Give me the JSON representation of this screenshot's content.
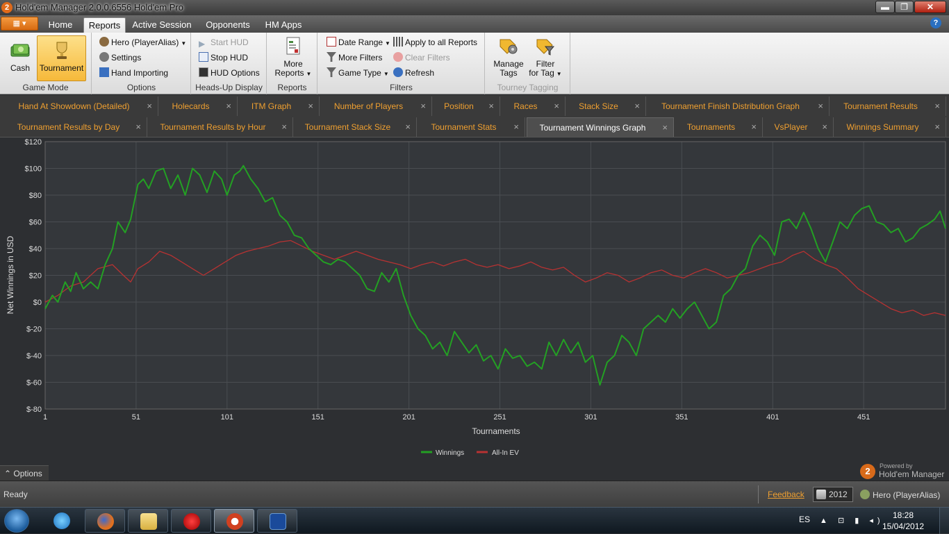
{
  "window": {
    "title": "Hold'em Manager 2.0.0.6556 Hold'em Pro",
    "logo_text": "2",
    "minimize": "▬",
    "maximize": "❐",
    "close": "✕"
  },
  "ribbon_tabs": [
    "Home",
    "Reports",
    "Active Session",
    "Opponents",
    "HM Apps"
  ],
  "active_ribbon_tab": "Reports",
  "help": "?",
  "ribbon": {
    "game_mode": {
      "label": "Game Mode",
      "cash": "Cash",
      "tournament": "Tournament"
    },
    "options": {
      "label": "Options",
      "hero": "Hero (PlayerAlias)",
      "settings": "Settings",
      "hand_importing": "Hand Importing"
    },
    "heads_up": {
      "label": "Heads-Up Display",
      "start_hud": "Start HUD",
      "stop_hud": "Stop HUD",
      "hud_options": "HUD Options"
    },
    "reports": {
      "label": "Reports",
      "more_reports_1": "More",
      "more_reports_2": "Reports"
    },
    "filters": {
      "label": "Filters",
      "date_range": "Date Range",
      "more_filters": "More Filters",
      "game_type": "Game Type",
      "apply_all": "Apply to all Reports",
      "clear_filters": "Clear Filters",
      "refresh": "Refresh"
    },
    "tourney_tagging": {
      "label": "Tourney Tagging",
      "manage_1": "Manage",
      "manage_2": "Tags",
      "filter_1": "Filter",
      "filter_2": "for Tag"
    }
  },
  "report_tabs_row1": [
    "Hand At Showdown (Detailed)",
    "Holecards",
    "ITM Graph",
    "Number of Players",
    "Position",
    "Races",
    "Stack Size",
    "Tournament Finish Distribution Graph",
    "Tournament Results"
  ],
  "report_tabs_row2": [
    "Tournament Results by Day",
    "Tournament Results by Hour",
    "Tournament Stack Size",
    "Tournament Stats",
    "Tournament Winnings Graph",
    "Tournaments",
    "VsPlayer",
    "Winnings Summary"
  ],
  "active_report_tab": "Tournament Winnings Graph",
  "tab_close": "×",
  "chart_data": {
    "type": "line",
    "title": "",
    "xlabel": "Tournaments",
    "ylabel": "Net Winnings in USD",
    "xlim": [
      1,
      496
    ],
    "ylim": [
      -80,
      120
    ],
    "x_ticks": [
      1,
      51,
      101,
      151,
      201,
      251,
      301,
      351,
      401,
      451
    ],
    "y_ticks": [
      "$120",
      "$100",
      "$80",
      "$60",
      "$40",
      "$20",
      "$0",
      "$-20",
      "$-40",
      "$-60",
      "$-80"
    ],
    "y_tick_values": [
      120,
      100,
      80,
      60,
      40,
      20,
      0,
      -20,
      -40,
      -60,
      -80
    ],
    "grid": true,
    "legend_position": "bottom-center",
    "series": [
      {
        "name": "Winnings",
        "color": "#23a023",
        "points": [
          [
            1,
            -5
          ],
          [
            5,
            5
          ],
          [
            8,
            0
          ],
          [
            12,
            15
          ],
          [
            15,
            8
          ],
          [
            18,
            22
          ],
          [
            22,
            10
          ],
          [
            26,
            15
          ],
          [
            30,
            10
          ],
          [
            34,
            28
          ],
          [
            38,
            40
          ],
          [
            41,
            60
          ],
          [
            45,
            52
          ],
          [
            48,
            62
          ],
          [
            52,
            88
          ],
          [
            55,
            92
          ],
          [
            58,
            85
          ],
          [
            62,
            98
          ],
          [
            66,
            100
          ],
          [
            70,
            85
          ],
          [
            74,
            95
          ],
          [
            78,
            80
          ],
          [
            82,
            100
          ],
          [
            86,
            95
          ],
          [
            90,
            82
          ],
          [
            94,
            98
          ],
          [
            98,
            92
          ],
          [
            101,
            80
          ],
          [
            105,
            95
          ],
          [
            108,
            98
          ],
          [
            110,
            102
          ],
          [
            114,
            92
          ],
          [
            118,
            85
          ],
          [
            122,
            75
          ],
          [
            126,
            78
          ],
          [
            130,
            65
          ],
          [
            134,
            60
          ],
          [
            138,
            50
          ],
          [
            142,
            48
          ],
          [
            146,
            40
          ],
          [
            150,
            35
          ],
          [
            154,
            30
          ],
          [
            158,
            28
          ],
          [
            162,
            32
          ],
          [
            166,
            30
          ],
          [
            170,
            25
          ],
          [
            174,
            20
          ],
          [
            178,
            10
          ],
          [
            182,
            8
          ],
          [
            186,
            22
          ],
          [
            190,
            15
          ],
          [
            194,
            25
          ],
          [
            198,
            5
          ],
          [
            202,
            -10
          ],
          [
            206,
            -20
          ],
          [
            210,
            -25
          ],
          [
            214,
            -35
          ],
          [
            218,
            -30
          ],
          [
            222,
            -40
          ],
          [
            226,
            -22
          ],
          [
            230,
            -30
          ],
          [
            234,
            -38
          ],
          [
            238,
            -32
          ],
          [
            242,
            -44
          ],
          [
            246,
            -40
          ],
          [
            250,
            -50
          ],
          [
            254,
            -35
          ],
          [
            258,
            -42
          ],
          [
            262,
            -40
          ],
          [
            266,
            -48
          ],
          [
            270,
            -45
          ],
          [
            274,
            -50
          ],
          [
            278,
            -30
          ],
          [
            282,
            -40
          ],
          [
            286,
            -28
          ],
          [
            290,
            -38
          ],
          [
            294,
            -30
          ],
          [
            298,
            -45
          ],
          [
            302,
            -40
          ],
          [
            306,
            -62
          ],
          [
            310,
            -45
          ],
          [
            314,
            -40
          ],
          [
            318,
            -25
          ],
          [
            322,
            -30
          ],
          [
            326,
            -40
          ],
          [
            330,
            -20
          ],
          [
            334,
            -15
          ],
          [
            338,
            -10
          ],
          [
            342,
            -15
          ],
          [
            346,
            -5
          ],
          [
            350,
            -12
          ],
          [
            354,
            -5
          ],
          [
            358,
            0
          ],
          [
            362,
            -10
          ],
          [
            366,
            -20
          ],
          [
            370,
            -15
          ],
          [
            374,
            5
          ],
          [
            378,
            10
          ],
          [
            382,
            20
          ],
          [
            386,
            25
          ],
          [
            390,
            42
          ],
          [
            394,
            50
          ],
          [
            398,
            45
          ],
          [
            402,
            35
          ],
          [
            406,
            60
          ],
          [
            410,
            62
          ],
          [
            414,
            55
          ],
          [
            418,
            67
          ],
          [
            422,
            55
          ],
          [
            426,
            40
          ],
          [
            430,
            30
          ],
          [
            434,
            45
          ],
          [
            438,
            60
          ],
          [
            442,
            55
          ],
          [
            446,
            65
          ],
          [
            450,
            70
          ],
          [
            454,
            72
          ],
          [
            458,
            60
          ],
          [
            462,
            58
          ],
          [
            466,
            52
          ],
          [
            470,
            55
          ],
          [
            474,
            45
          ],
          [
            478,
            48
          ],
          [
            482,
            55
          ],
          [
            486,
            58
          ],
          [
            490,
            62
          ],
          [
            493,
            68
          ],
          [
            496,
            55
          ]
        ]
      },
      {
        "name": "All-In EV",
        "color": "#b83232",
        "points": [
          [
            1,
            0
          ],
          [
            8,
            5
          ],
          [
            15,
            12
          ],
          [
            22,
            15
          ],
          [
            30,
            25
          ],
          [
            38,
            28
          ],
          [
            44,
            20
          ],
          [
            48,
            15
          ],
          [
            52,
            25
          ],
          [
            58,
            30
          ],
          [
            64,
            38
          ],
          [
            70,
            35
          ],
          [
            76,
            30
          ],
          [
            82,
            25
          ],
          [
            88,
            20
          ],
          [
            94,
            25
          ],
          [
            100,
            30
          ],
          [
            106,
            35
          ],
          [
            112,
            38
          ],
          [
            118,
            40
          ],
          [
            124,
            42
          ],
          [
            130,
            45
          ],
          [
            136,
            46
          ],
          [
            142,
            42
          ],
          [
            148,
            38
          ],
          [
            154,
            35
          ],
          [
            160,
            32
          ],
          [
            166,
            35
          ],
          [
            172,
            38
          ],
          [
            178,
            35
          ],
          [
            184,
            32
          ],
          [
            190,
            30
          ],
          [
            196,
            28
          ],
          [
            202,
            25
          ],
          [
            208,
            28
          ],
          [
            214,
            30
          ],
          [
            220,
            27
          ],
          [
            226,
            30
          ],
          [
            232,
            32
          ],
          [
            238,
            28
          ],
          [
            244,
            26
          ],
          [
            250,
            28
          ],
          [
            256,
            25
          ],
          [
            262,
            27
          ],
          [
            268,
            30
          ],
          [
            274,
            26
          ],
          [
            280,
            24
          ],
          [
            286,
            26
          ],
          [
            292,
            20
          ],
          [
            298,
            15
          ],
          [
            304,
            18
          ],
          [
            310,
            22
          ],
          [
            316,
            20
          ],
          [
            322,
            15
          ],
          [
            328,
            18
          ],
          [
            334,
            22
          ],
          [
            340,
            24
          ],
          [
            346,
            20
          ],
          [
            352,
            18
          ],
          [
            358,
            22
          ],
          [
            364,
            25
          ],
          [
            370,
            22
          ],
          [
            376,
            18
          ],
          [
            382,
            20
          ],
          [
            388,
            22
          ],
          [
            394,
            25
          ],
          [
            400,
            28
          ],
          [
            406,
            30
          ],
          [
            412,
            35
          ],
          [
            418,
            38
          ],
          [
            424,
            32
          ],
          [
            430,
            28
          ],
          [
            436,
            25
          ],
          [
            442,
            18
          ],
          [
            448,
            10
          ],
          [
            454,
            5
          ],
          [
            460,
            0
          ],
          [
            466,
            -5
          ],
          [
            472,
            -8
          ],
          [
            478,
            -6
          ],
          [
            484,
            -10
          ],
          [
            490,
            -8
          ],
          [
            496,
            -10
          ]
        ]
      }
    ]
  },
  "options_label": "Options",
  "branding": {
    "logo": "2",
    "powered_by": "Powered by",
    "name": "Hold'em Manager"
  },
  "status": {
    "ready": "Ready",
    "feedback": "Feedback",
    "year": "2012",
    "hero": "Hero (PlayerAlias)"
  },
  "taskbar": {
    "language": "ES",
    "tray": "▲ ⊡ ▮ ◂)",
    "time": "18:28",
    "date": "15/04/2012",
    "apps": [
      "ie-icon",
      "firefox-icon",
      "explorer-icon",
      "pokerstars-icon",
      "holdem-manager-icon",
      "pse-icon"
    ]
  }
}
